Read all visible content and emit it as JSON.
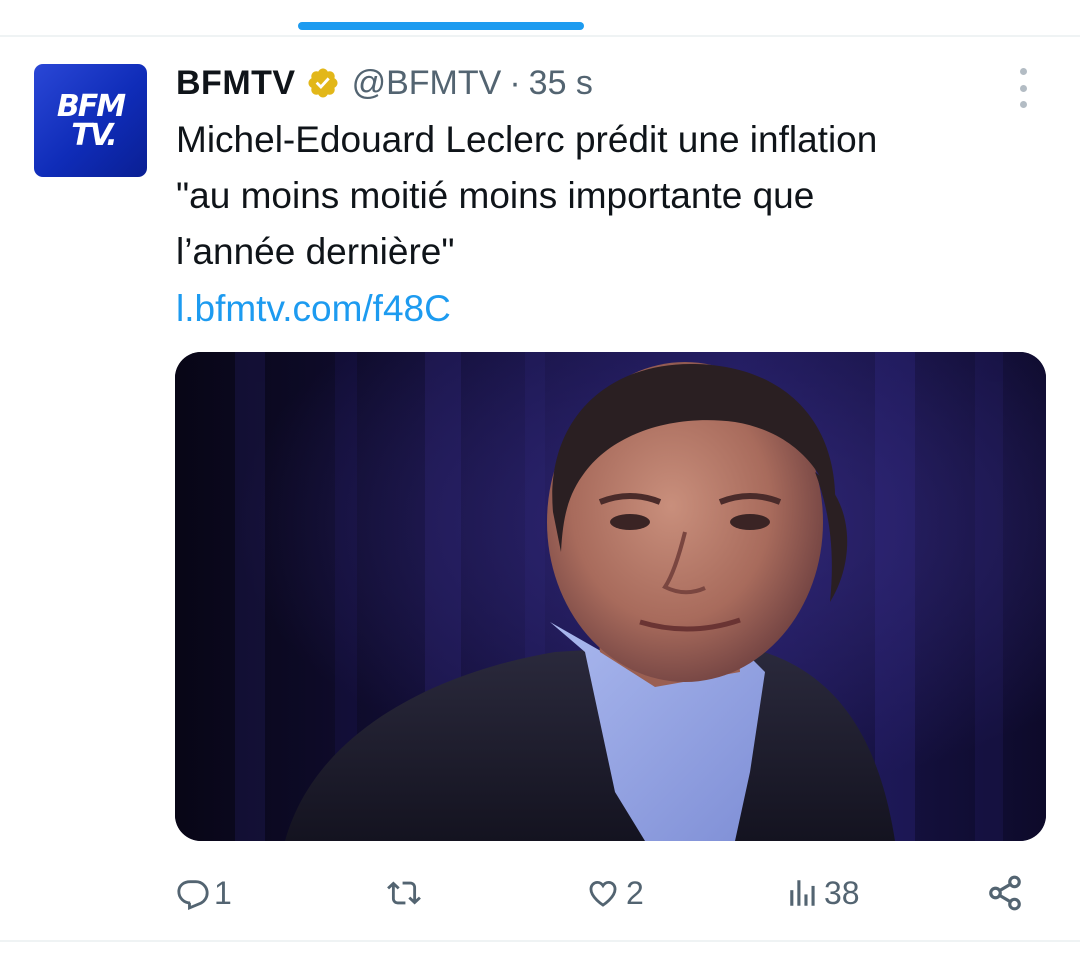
{
  "tweet": {
    "display_name": "BFMTV",
    "handle": "@BFMTV",
    "separator": "·",
    "time": "35 s",
    "avatar_text_line1": "BFM",
    "avatar_text_line2": "TV.",
    "text_lines": [
      "Michel-Edouard Leclerc prédit une inflation",
      "\"au moins moitié moins importante que",
      "l’année dernière\""
    ],
    "link": "l.bfmtv.com/f48C",
    "verified_badge": "gold-verified-icon"
  },
  "actions": {
    "replies": "1",
    "retweets": "",
    "likes": "2",
    "views": "38"
  },
  "colors": {
    "accent": "#1d9bf0",
    "text": "#0f1419",
    "secondary_text": "#536471",
    "verified_gold": "#e2b719",
    "avatar_blue": "#1634c6"
  }
}
